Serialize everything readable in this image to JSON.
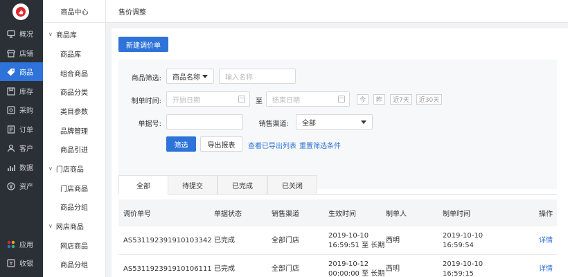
{
  "nav1": {
    "items": [
      {
        "label": "概况",
        "icon": "overview-icon"
      },
      {
        "label": "店铺",
        "icon": "store-icon"
      },
      {
        "label": "商品",
        "icon": "tag-icon",
        "active": true
      },
      {
        "label": "库存",
        "icon": "inventory-icon"
      },
      {
        "label": "采购",
        "icon": "purchase-icon"
      },
      {
        "label": "订单",
        "icon": "order-icon"
      },
      {
        "label": "客户",
        "icon": "customer-icon"
      },
      {
        "label": "数据",
        "icon": "data-icon"
      },
      {
        "label": "资产",
        "icon": "asset-icon"
      }
    ],
    "bottom_items": [
      {
        "label": "应用",
        "icon": "apps-icon"
      },
      {
        "label": "收银",
        "icon": "cashier-icon"
      }
    ]
  },
  "nav2": {
    "title": "商品中心",
    "groups": [
      {
        "label": "商品库",
        "items": [
          "商品库",
          "组合商品",
          "商品分类",
          "类目参数",
          "品牌管理",
          "商品引进"
        ]
      },
      {
        "label": "门店商品",
        "items": [
          "门店商品",
          "商品分组"
        ]
      },
      {
        "label": "网店商品",
        "items": [
          "网店商品",
          "商品分组"
        ]
      }
    ]
  },
  "topbar": {
    "title": "售价调整"
  },
  "toolbar": {
    "new_button": "新建调价单"
  },
  "filter": {
    "product_filter_label": "商品筛选:",
    "product_filter_select": "商品名称",
    "product_filter_placeholder": "输入名称",
    "date_label": "制单时间:",
    "start_placeholder": "开始日期",
    "to_label": "至",
    "end_placeholder": "结束日期",
    "quick_dates": [
      "今",
      "昨",
      "近7天",
      "近30天"
    ],
    "order_no_label": "单据号:",
    "channel_label": "销售渠道:",
    "channel_value": "全部",
    "search_button": "筛选",
    "export_button": "导出报表",
    "export_list_link": "查看已导出列表",
    "reset_link": "重置筛选条件"
  },
  "tabs": [
    "全部",
    "待提交",
    "已完成",
    "已关闭"
  ],
  "table": {
    "columns": [
      "调价单号",
      "单据状态",
      "销售渠道",
      "生效时间",
      "制单人",
      "制单时间",
      "操作"
    ],
    "rows": [
      {
        "id": "AS531192391910103342",
        "status": "已完成",
        "channel": "全部门店",
        "effective_line1": "2019-10-10",
        "effective_line2": "16:59:51 至 长期",
        "creator": "西明",
        "created_line1": "2019-10-10",
        "created_line2": "16:59:54",
        "action": "详情"
      },
      {
        "id": "AS531192391910106111",
        "status": "已完成",
        "channel": "全部门店",
        "effective_line1": "2019-10-12",
        "effective_line2": "00:00:00 至 长期",
        "creator": "西明",
        "created_line1": "2019-10-10",
        "created_line2": "16:59:15",
        "action": "详情"
      }
    ]
  },
  "colors": {
    "primary": "#2d73d9",
    "sidebar": "#2b2f36",
    "brand_red": "#e0262c"
  }
}
